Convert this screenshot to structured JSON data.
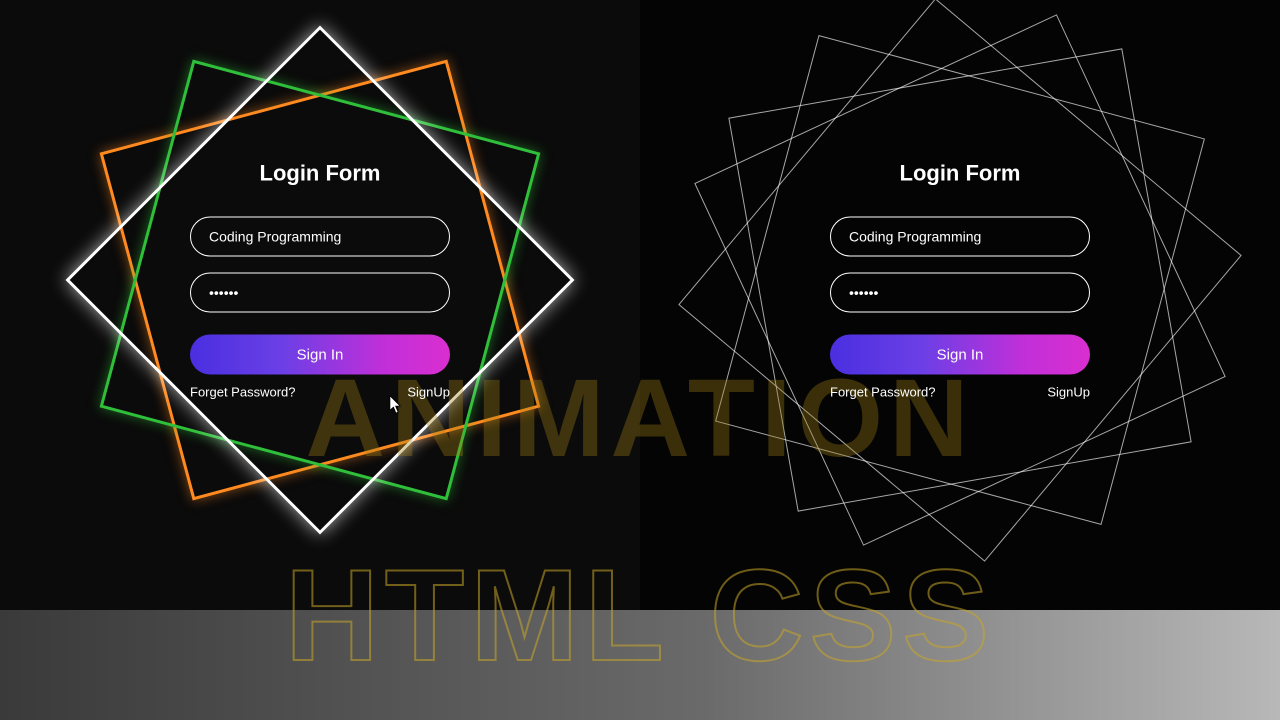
{
  "watermark": {
    "line1": "ANIMATION",
    "line2": "HTML CSS"
  },
  "forms": {
    "left": {
      "title": "Login Form",
      "username_value": "Coding Programming",
      "password_value": "••••••",
      "submit_label": "Sign In",
      "forgot_label": "Forget Password?",
      "signup_label": "SignUp"
    },
    "right": {
      "title": "Login Form",
      "username_value": "Coding Programming",
      "password_value": "••••••",
      "submit_label": "Sign In",
      "forgot_label": "Forget Password?",
      "signup_label": "SignUp"
    }
  },
  "colors": {
    "orange": "#ff8a1f",
    "green": "#2fbf3a",
    "white": "#ffffff",
    "btn_start": "#4a2fe0",
    "btn_end": "#d92fd0"
  }
}
